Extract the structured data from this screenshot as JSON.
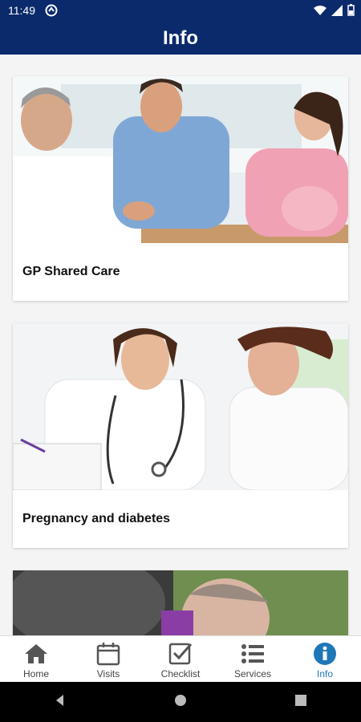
{
  "status": {
    "time": "11:49"
  },
  "header": {
    "title": "Info"
  },
  "cards": [
    {
      "label": "GP Shared Care"
    },
    {
      "label": "Pregnancy and diabetes"
    },
    {
      "label": ""
    }
  ],
  "nav": {
    "items": [
      {
        "label": "Home",
        "icon": "home-icon"
      },
      {
        "label": "Visits",
        "icon": "calendar-icon"
      },
      {
        "label": "Checklist",
        "icon": "checklist-icon"
      },
      {
        "label": "Services",
        "icon": "list-icon"
      },
      {
        "label": "Info",
        "icon": "info-icon",
        "active": true
      }
    ],
    "active_color": "#1e77b8"
  },
  "colors": {
    "brand": "#0a2a6b"
  }
}
